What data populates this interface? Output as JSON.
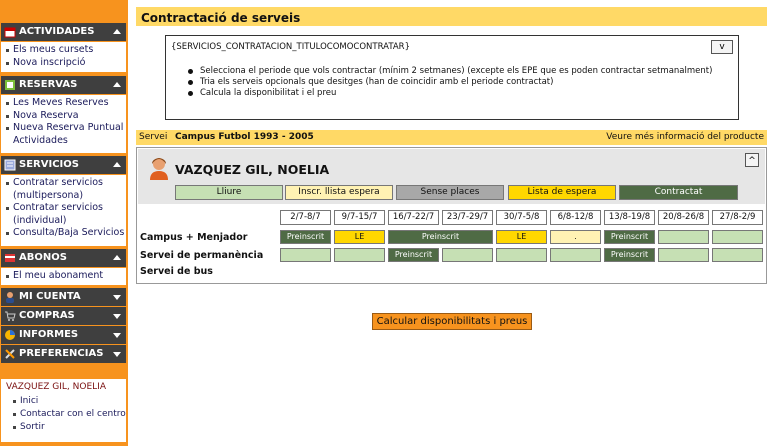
{
  "sidebar": {
    "sections": [
      {
        "title": "ACTIVIDADES",
        "icon": "calendar-icon",
        "items": [
          "Els meus cursets",
          "Nova inscripció"
        ]
      },
      {
        "title": "RESERVAS",
        "icon": "reservation-icon",
        "items": [
          "Les Meves Reserves",
          "Nova Reserva",
          "Nueva Reserva Puntual Actividades"
        ]
      },
      {
        "title": "SERVICIOS",
        "icon": "services-icon",
        "items": [
          "Contratar servicios (multipersona)",
          "Contratar servicios (individual)",
          "Consulta/Baja Servicios"
        ]
      },
      {
        "title": "ABONOS",
        "icon": "card-icon",
        "items": [
          "El meu abonament"
        ]
      },
      {
        "title": "MI CUENTA",
        "icon": "user-icon",
        "items": []
      },
      {
        "title": "COMPRAS",
        "icon": "cart-icon",
        "items": []
      },
      {
        "title": "INFORMES",
        "icon": "report-icon",
        "items": []
      },
      {
        "title": "PREFERENCIAS",
        "icon": "tools-icon",
        "items": []
      }
    ],
    "user": {
      "name": "VAZQUEZ GIL, NOELIA",
      "links": [
        "Inici",
        "Contactar con el centro",
        "Sortir"
      ]
    }
  },
  "main": {
    "title": "Contractació de serveis",
    "info": {
      "code": "{SERVICIOS_CONTRATACION_TITULOCOMOCONTRATAR}",
      "toggle": "v",
      "bullets": [
        "Selecciona el periode que vols contractar (mínim 2 setmanes) (excepte els EPE que es poden contractar setmanalment)",
        "Tria els serveis opcionals que desitges (han de coincidir amb el periode contractat)",
        "Calcula la disponibilitat i el preu"
      ]
    },
    "service": {
      "label": "Servei",
      "name": "Campus Futbol 1993 - 2005",
      "more": "Veure més informació del producte"
    },
    "student": {
      "name": "VAZQUEZ GIL, NOELIA",
      "collapse": "^"
    },
    "legend": [
      "Lliure",
      "Inscr. llista espera",
      "Sense places",
      "Lista de espera",
      "Contractat"
    ],
    "weeks": [
      "2/7-8/7",
      "9/7-15/7",
      "16/7-22/7",
      "23/7-29/7",
      "30/7-5/8",
      "6/8-12/8",
      "13/8-19/8",
      "20/8-26/8",
      "27/8-2/9"
    ],
    "rows": [
      {
        "label": "Campus + Menjador"
      },
      {
        "label": "Servei de permanència"
      },
      {
        "label": "Servei de bus"
      }
    ],
    "cells": {
      "preinscrit": "Preinscrit",
      "le": "LE",
      "dot": "."
    },
    "calc_button": "Calcular disponibilitats i preus"
  },
  "colors": {
    "accent": "#f7931e",
    "header_bar": "#ffd966",
    "sidebar_section": "#3f3f3f",
    "free": "#c6e0b4",
    "waitlist_inscr": "#fff2b3",
    "full": "#a8a8a8",
    "waitlist": "#ffd700",
    "contracted": "#4f6b45"
  }
}
